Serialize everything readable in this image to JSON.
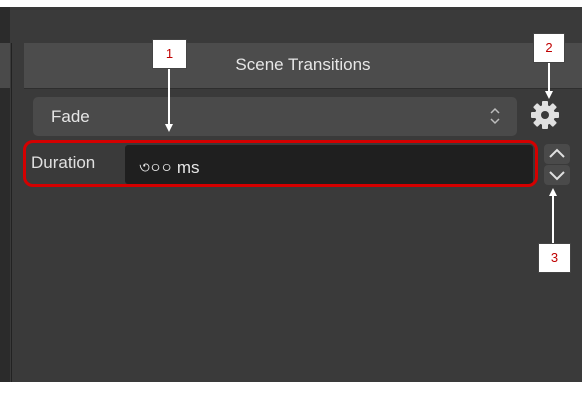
{
  "panel": {
    "title": "Scene Transitions"
  },
  "transition_select": {
    "selected": "Fade"
  },
  "duration": {
    "label": "Duration",
    "value": "৩০০ ms"
  },
  "callouts": {
    "one": "1",
    "two": "2",
    "three": "3"
  },
  "icons": {
    "properties": "gear-icon",
    "select": "chevron-updown-icon",
    "increase": "chevron-up-icon",
    "decrease": "chevron-down-icon"
  },
  "colors": {
    "highlight": "#d40000",
    "callout_text": "#c00000"
  }
}
